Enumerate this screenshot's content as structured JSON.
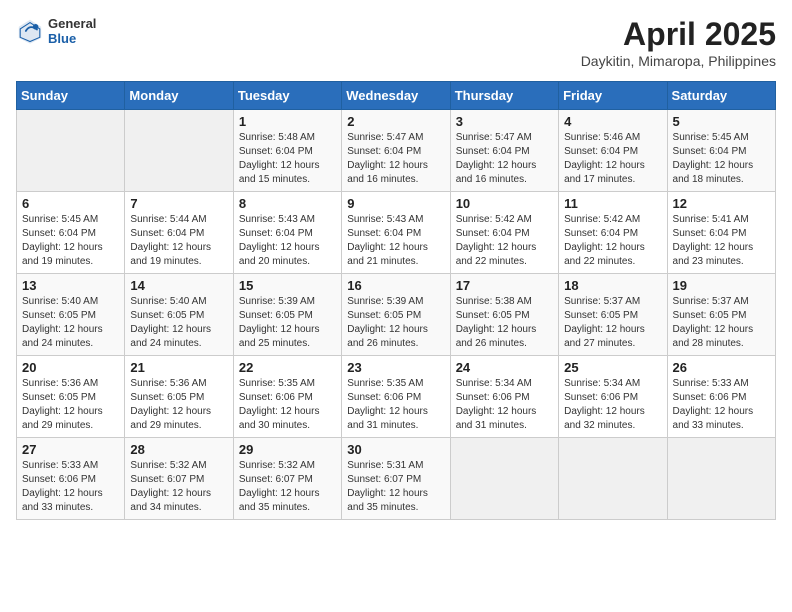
{
  "header": {
    "logo_general": "General",
    "logo_blue": "Blue",
    "title": "April 2025",
    "location": "Daykitin, Mimaropa, Philippines"
  },
  "calendar": {
    "days_of_week": [
      "Sunday",
      "Monday",
      "Tuesday",
      "Wednesday",
      "Thursday",
      "Friday",
      "Saturday"
    ],
    "weeks": [
      [
        {
          "day": "",
          "content": ""
        },
        {
          "day": "",
          "content": ""
        },
        {
          "day": "1",
          "content": "Sunrise: 5:48 AM\nSunset: 6:04 PM\nDaylight: 12 hours and 15 minutes."
        },
        {
          "day": "2",
          "content": "Sunrise: 5:47 AM\nSunset: 6:04 PM\nDaylight: 12 hours and 16 minutes."
        },
        {
          "day": "3",
          "content": "Sunrise: 5:47 AM\nSunset: 6:04 PM\nDaylight: 12 hours and 16 minutes."
        },
        {
          "day": "4",
          "content": "Sunrise: 5:46 AM\nSunset: 6:04 PM\nDaylight: 12 hours and 17 minutes."
        },
        {
          "day": "5",
          "content": "Sunrise: 5:45 AM\nSunset: 6:04 PM\nDaylight: 12 hours and 18 minutes."
        }
      ],
      [
        {
          "day": "6",
          "content": "Sunrise: 5:45 AM\nSunset: 6:04 PM\nDaylight: 12 hours and 19 minutes."
        },
        {
          "day": "7",
          "content": "Sunrise: 5:44 AM\nSunset: 6:04 PM\nDaylight: 12 hours and 19 minutes."
        },
        {
          "day": "8",
          "content": "Sunrise: 5:43 AM\nSunset: 6:04 PM\nDaylight: 12 hours and 20 minutes."
        },
        {
          "day": "9",
          "content": "Sunrise: 5:43 AM\nSunset: 6:04 PM\nDaylight: 12 hours and 21 minutes."
        },
        {
          "day": "10",
          "content": "Sunrise: 5:42 AM\nSunset: 6:04 PM\nDaylight: 12 hours and 22 minutes."
        },
        {
          "day": "11",
          "content": "Sunrise: 5:42 AM\nSunset: 6:04 PM\nDaylight: 12 hours and 22 minutes."
        },
        {
          "day": "12",
          "content": "Sunrise: 5:41 AM\nSunset: 6:04 PM\nDaylight: 12 hours and 23 minutes."
        }
      ],
      [
        {
          "day": "13",
          "content": "Sunrise: 5:40 AM\nSunset: 6:05 PM\nDaylight: 12 hours and 24 minutes."
        },
        {
          "day": "14",
          "content": "Sunrise: 5:40 AM\nSunset: 6:05 PM\nDaylight: 12 hours and 24 minutes."
        },
        {
          "day": "15",
          "content": "Sunrise: 5:39 AM\nSunset: 6:05 PM\nDaylight: 12 hours and 25 minutes."
        },
        {
          "day": "16",
          "content": "Sunrise: 5:39 AM\nSunset: 6:05 PM\nDaylight: 12 hours and 26 minutes."
        },
        {
          "day": "17",
          "content": "Sunrise: 5:38 AM\nSunset: 6:05 PM\nDaylight: 12 hours and 26 minutes."
        },
        {
          "day": "18",
          "content": "Sunrise: 5:37 AM\nSunset: 6:05 PM\nDaylight: 12 hours and 27 minutes."
        },
        {
          "day": "19",
          "content": "Sunrise: 5:37 AM\nSunset: 6:05 PM\nDaylight: 12 hours and 28 minutes."
        }
      ],
      [
        {
          "day": "20",
          "content": "Sunrise: 5:36 AM\nSunset: 6:05 PM\nDaylight: 12 hours and 29 minutes."
        },
        {
          "day": "21",
          "content": "Sunrise: 5:36 AM\nSunset: 6:05 PM\nDaylight: 12 hours and 29 minutes."
        },
        {
          "day": "22",
          "content": "Sunrise: 5:35 AM\nSunset: 6:06 PM\nDaylight: 12 hours and 30 minutes."
        },
        {
          "day": "23",
          "content": "Sunrise: 5:35 AM\nSunset: 6:06 PM\nDaylight: 12 hours and 31 minutes."
        },
        {
          "day": "24",
          "content": "Sunrise: 5:34 AM\nSunset: 6:06 PM\nDaylight: 12 hours and 31 minutes."
        },
        {
          "day": "25",
          "content": "Sunrise: 5:34 AM\nSunset: 6:06 PM\nDaylight: 12 hours and 32 minutes."
        },
        {
          "day": "26",
          "content": "Sunrise: 5:33 AM\nSunset: 6:06 PM\nDaylight: 12 hours and 33 minutes."
        }
      ],
      [
        {
          "day": "27",
          "content": "Sunrise: 5:33 AM\nSunset: 6:06 PM\nDaylight: 12 hours and 33 minutes."
        },
        {
          "day": "28",
          "content": "Sunrise: 5:32 AM\nSunset: 6:07 PM\nDaylight: 12 hours and 34 minutes."
        },
        {
          "day": "29",
          "content": "Sunrise: 5:32 AM\nSunset: 6:07 PM\nDaylight: 12 hours and 35 minutes."
        },
        {
          "day": "30",
          "content": "Sunrise: 5:31 AM\nSunset: 6:07 PM\nDaylight: 12 hours and 35 minutes."
        },
        {
          "day": "",
          "content": ""
        },
        {
          "day": "",
          "content": ""
        },
        {
          "day": "",
          "content": ""
        }
      ]
    ]
  }
}
